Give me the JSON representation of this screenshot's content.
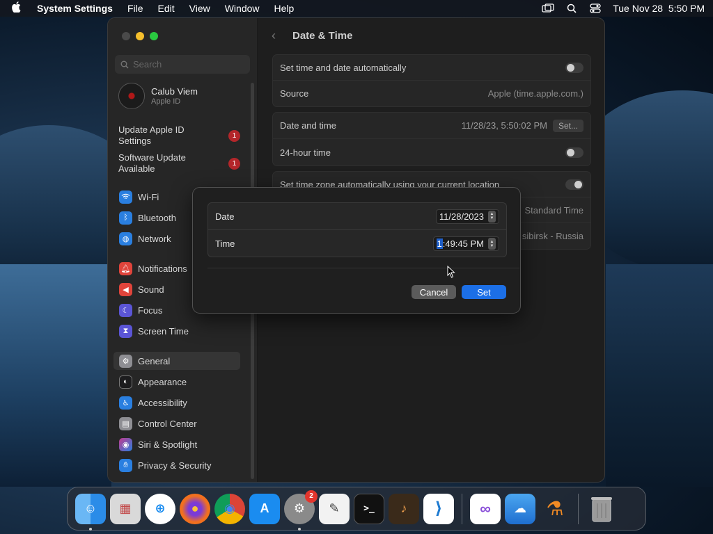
{
  "menubar": {
    "app_name": "System Settings",
    "menus": [
      "File",
      "Edit",
      "View",
      "Window",
      "Help"
    ],
    "clock": "Tue Nov 28  5:50 PM"
  },
  "sidebar": {
    "search_placeholder": "Search",
    "profile": {
      "name": "Calub Viem",
      "subtitle": "Apple ID"
    },
    "alerts": [
      {
        "label": "Update Apple ID Settings",
        "badge": "1"
      },
      {
        "label": "Software Update Available",
        "badge": "1"
      }
    ],
    "items": [
      {
        "label": "Wi-Fi",
        "icon": "wifi-icon",
        "color": "#2a7fe0"
      },
      {
        "label": "Bluetooth",
        "icon": "bluetooth-icon",
        "color": "#2a7fe0"
      },
      {
        "label": "Network",
        "icon": "globe-icon",
        "color": "#2a7fe0"
      },
      {
        "label": "Notifications",
        "icon": "bell-icon",
        "color": "#e0443b"
      },
      {
        "label": "Sound",
        "icon": "speaker-icon",
        "color": "#e0443b"
      },
      {
        "label": "Focus",
        "icon": "moon-icon",
        "color": "#5b55d6"
      },
      {
        "label": "Screen Time",
        "icon": "hourglass-icon",
        "color": "#5b55d6"
      },
      {
        "label": "General",
        "icon": "gear-icon",
        "color": "#8e8e93"
      },
      {
        "label": "Appearance",
        "icon": "appearance-icon",
        "color": "#1c1c1e"
      },
      {
        "label": "Accessibility",
        "icon": "accessibility-icon",
        "color": "#2a7fe0"
      },
      {
        "label": "Control Center",
        "icon": "control-center-icon",
        "color": "#8e8e93"
      },
      {
        "label": "Siri & Spotlight",
        "icon": "siri-icon",
        "color": "#c23b8f"
      },
      {
        "label": "Privacy & Security",
        "icon": "hand-icon",
        "color": "#2a7fe0"
      }
    ]
  },
  "main": {
    "title": "Date & Time",
    "rows": {
      "auto_time": "Set time and date automatically",
      "source_label": "Source",
      "source_value": "Apple (time.apple.com.)",
      "date_time_label": "Date and time",
      "date_time_value": "11/28/23, 5:50:02 PM",
      "set_button": "Set...",
      "hour24": "24-hour time",
      "tz_auto": "Set time zone automatically using your current location",
      "tz_partial": "Standard Time",
      "city_partial": "sibirsk - Russia"
    },
    "help": "?"
  },
  "sheet": {
    "date_label": "Date",
    "date_value": "11/28/2023",
    "time_label": "Time",
    "time_highlight": "1",
    "time_rest": ":49:45 PM",
    "cancel": "Cancel",
    "set": "Set"
  },
  "dock": {
    "apps": [
      {
        "name": "Finder",
        "glyph": "☺",
        "color": "#2b8ce8"
      },
      {
        "name": "Launchpad",
        "glyph": "▦",
        "color": "#d9d9d9"
      },
      {
        "name": "Safari",
        "glyph": "⊕",
        "color": "#ffffff"
      },
      {
        "name": "Firefox",
        "glyph": "●",
        "color": "#e8541f"
      },
      {
        "name": "Chrome",
        "glyph": "◉",
        "color": "#ffffff"
      },
      {
        "name": "App Store",
        "glyph": "A",
        "color": "#1a8cf0"
      },
      {
        "name": "System Settings",
        "glyph": "⚙",
        "color": "#8a8a8a",
        "badge": "2"
      },
      {
        "name": "TextEdit",
        "glyph": "✎",
        "color": "#f2f2f2"
      },
      {
        "name": "Terminal",
        "glyph": ">_",
        "color": "#111111"
      },
      {
        "name": "GarageBand",
        "glyph": "♪",
        "color": "#3a2a1a"
      },
      {
        "name": "VS Code",
        "glyph": "⟩",
        "color": "#ffffff"
      },
      {
        "name": "Visual Studio",
        "glyph": "∞",
        "color": "#ffffff"
      },
      {
        "name": "Weather",
        "glyph": "☁",
        "color": "#2f8fe0"
      },
      {
        "name": "Potion",
        "glyph": "⚗",
        "color": "#f08a24"
      },
      {
        "name": "Trash",
        "glyph": "🗑",
        "color": "#7d7d7d"
      }
    ]
  }
}
